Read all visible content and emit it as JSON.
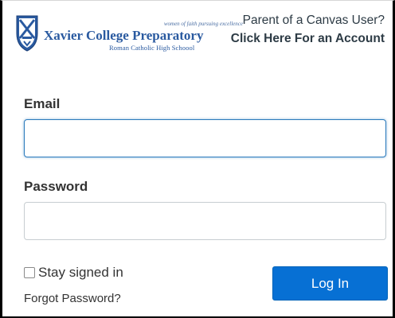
{
  "header": {
    "tagline": "women of faith pursuing excellence",
    "college_name": "Xavier College Preparatory",
    "subtitle": "Roman Catholic High Schoool",
    "parent_question": "Parent of a Canvas User?",
    "parent_link": "Click Here For an Account"
  },
  "form": {
    "email_label": "Email",
    "email_value": "",
    "password_label": "Password",
    "password_value": "",
    "stay_signed_in_label": "Stay signed in",
    "stay_signed_in_checked": false,
    "forgot_password": "Forgot Password?",
    "login_button": "Log In"
  },
  "colors": {
    "brand_blue": "#2a5aa0",
    "button_blue": "#0770d4",
    "focus_border": "#2b7abc"
  }
}
